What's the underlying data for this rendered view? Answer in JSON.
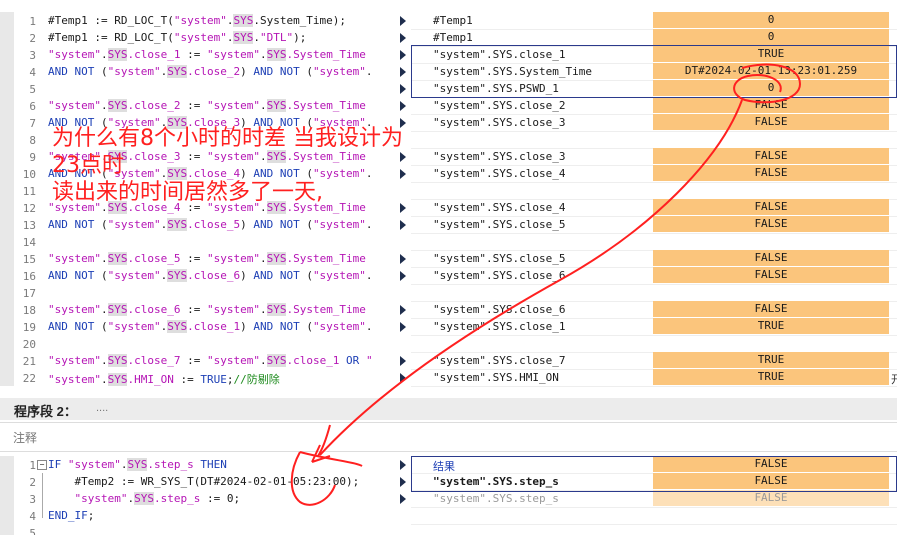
{
  "segment1": {
    "lines": [
      {
        "n": "1",
        "parts": [
          [
            "t",
            "#Temp1 := RD_LOC_T("
          ],
          [
            "s",
            "\"system\""
          ],
          [
            "t",
            "."
          ],
          [
            "y",
            "SYS"
          ],
          [
            "t",
            ".System_Time);"
          ]
        ]
      },
      {
        "n": "2",
        "parts": [
          [
            "t",
            "#Temp1 := RD_LOC_T("
          ],
          [
            "s",
            "\"system\""
          ],
          [
            "t",
            "."
          ],
          [
            "y",
            "SYS"
          ],
          [
            "t",
            "."
          ],
          [
            "s",
            "\"DTL\""
          ],
          [
            "t",
            ");"
          ]
        ]
      },
      {
        "n": "3",
        "parts": [
          [
            "s",
            "\"system\""
          ],
          [
            "t",
            "."
          ],
          [
            "y",
            "SYS"
          ],
          [
            "s",
            ".close_1"
          ],
          [
            "t",
            " := "
          ],
          [
            "s",
            "\"system\""
          ],
          [
            "t",
            "."
          ],
          [
            "y",
            "SYS"
          ],
          [
            "s",
            ".System_Time"
          ]
        ]
      },
      {
        "n": "4",
        "parts": [
          [
            "k",
            "AND NOT "
          ],
          [
            "t",
            "("
          ],
          [
            "s",
            "\"system\""
          ],
          [
            "t",
            "."
          ],
          [
            "y",
            "SYS"
          ],
          [
            "s",
            ".close_2"
          ],
          [
            "t",
            ") "
          ],
          [
            "k",
            "AND NOT "
          ],
          [
            "t",
            "("
          ],
          [
            "s",
            "\"system\""
          ],
          [
            "t",
            "."
          ]
        ]
      },
      {
        "n": "5",
        "parts": []
      },
      {
        "n": "6",
        "parts": [
          [
            "s",
            "\"system\""
          ],
          [
            "t",
            "."
          ],
          [
            "y",
            "SYS"
          ],
          [
            "s",
            ".close_2"
          ],
          [
            "t",
            " := "
          ],
          [
            "s",
            "\"system\""
          ],
          [
            "t",
            "."
          ],
          [
            "y",
            "SYS"
          ],
          [
            "s",
            ".System_Time"
          ]
        ]
      },
      {
        "n": "7",
        "parts": [
          [
            "k",
            "AND NOT "
          ],
          [
            "t",
            "("
          ],
          [
            "s",
            "\"system\""
          ],
          [
            "t",
            "."
          ],
          [
            "y",
            "SYS"
          ],
          [
            "s",
            ".close_3"
          ],
          [
            "t",
            ") "
          ],
          [
            "k",
            "AND NOT "
          ],
          [
            "t",
            "("
          ],
          [
            "s",
            "\"system\""
          ],
          [
            "t",
            "."
          ]
        ]
      },
      {
        "n": "8",
        "parts": []
      },
      {
        "n": "9",
        "parts": [
          [
            "s",
            "\"system\""
          ],
          [
            "t",
            "."
          ],
          [
            "y",
            "SYS"
          ],
          [
            "s",
            ".close_3"
          ],
          [
            "t",
            " := "
          ],
          [
            "s",
            "\"system\""
          ],
          [
            "t",
            "."
          ],
          [
            "y",
            "SYS"
          ],
          [
            "s",
            ".System_Time"
          ]
        ]
      },
      {
        "n": "10",
        "parts": [
          [
            "k",
            "AND NOT "
          ],
          [
            "t",
            "("
          ],
          [
            "s",
            "\"system\""
          ],
          [
            "t",
            "."
          ],
          [
            "y",
            "SYS"
          ],
          [
            "s",
            ".close_4"
          ],
          [
            "t",
            ") "
          ],
          [
            "k",
            "AND NOT "
          ],
          [
            "t",
            "("
          ],
          [
            "s",
            "\"system\""
          ],
          [
            "t",
            "."
          ]
        ]
      },
      {
        "n": "11",
        "parts": []
      },
      {
        "n": "12",
        "parts": [
          [
            "s",
            "\"system\""
          ],
          [
            "t",
            "."
          ],
          [
            "y",
            "SYS"
          ],
          [
            "s",
            ".close_4"
          ],
          [
            "t",
            " := "
          ],
          [
            "s",
            "\"system\""
          ],
          [
            "t",
            "."
          ],
          [
            "y",
            "SYS"
          ],
          [
            "s",
            ".System_Time"
          ]
        ]
      },
      {
        "n": "13",
        "parts": [
          [
            "k",
            "AND NOT "
          ],
          [
            "t",
            "("
          ],
          [
            "s",
            "\"system\""
          ],
          [
            "t",
            "."
          ],
          [
            "y",
            "SYS"
          ],
          [
            "s",
            ".close_5"
          ],
          [
            "t",
            ") "
          ],
          [
            "k",
            "AND NOT "
          ],
          [
            "t",
            "("
          ],
          [
            "s",
            "\"system\""
          ],
          [
            "t",
            "."
          ]
        ]
      },
      {
        "n": "14",
        "parts": []
      },
      {
        "n": "15",
        "parts": [
          [
            "s",
            "\"system\""
          ],
          [
            "t",
            "."
          ],
          [
            "y",
            "SYS"
          ],
          [
            "s",
            ".close_5"
          ],
          [
            "t",
            " := "
          ],
          [
            "s",
            "\"system\""
          ],
          [
            "t",
            "."
          ],
          [
            "y",
            "SYS"
          ],
          [
            "s",
            ".System_Time"
          ]
        ]
      },
      {
        "n": "16",
        "parts": [
          [
            "k",
            "AND NOT "
          ],
          [
            "t",
            "("
          ],
          [
            "s",
            "\"system\""
          ],
          [
            "t",
            "."
          ],
          [
            "y",
            "SYS"
          ],
          [
            "s",
            ".close_6"
          ],
          [
            "t",
            ") "
          ],
          [
            "k",
            "AND NOT "
          ],
          [
            "t",
            "("
          ],
          [
            "s",
            "\"system\""
          ],
          [
            "t",
            "."
          ]
        ]
      },
      {
        "n": "17",
        "parts": []
      },
      {
        "n": "18",
        "parts": [
          [
            "s",
            "\"system\""
          ],
          [
            "t",
            "."
          ],
          [
            "y",
            "SYS"
          ],
          [
            "s",
            ".close_6"
          ],
          [
            "t",
            " := "
          ],
          [
            "s",
            "\"system\""
          ],
          [
            "t",
            "."
          ],
          [
            "y",
            "SYS"
          ],
          [
            "s",
            ".System_Time"
          ]
        ]
      },
      {
        "n": "19",
        "parts": [
          [
            "k",
            "AND NOT "
          ],
          [
            "t",
            "("
          ],
          [
            "s",
            "\"system\""
          ],
          [
            "t",
            "."
          ],
          [
            "y",
            "SYS"
          ],
          [
            "s",
            ".close_1"
          ],
          [
            "t",
            ") "
          ],
          [
            "k",
            "AND NOT "
          ],
          [
            "t",
            "("
          ],
          [
            "s",
            "\"system\""
          ],
          [
            "t",
            "."
          ]
        ]
      },
      {
        "n": "20",
        "parts": []
      },
      {
        "n": "21",
        "parts": [
          [
            "s",
            "\"system\""
          ],
          [
            "t",
            "."
          ],
          [
            "y",
            "SYS"
          ],
          [
            "s",
            ".close_7"
          ],
          [
            "t",
            " := "
          ],
          [
            "s",
            "\"system\""
          ],
          [
            "t",
            "."
          ],
          [
            "y",
            "SYS"
          ],
          [
            "s",
            ".close_1"
          ],
          [
            "k",
            " OR "
          ],
          [
            "s",
            "\""
          ]
        ]
      },
      {
        "n": "22",
        "parts": [
          [
            "s",
            "\"system\""
          ],
          [
            "t",
            "."
          ],
          [
            "y",
            "SYS"
          ],
          [
            "s",
            ".HMI_ON"
          ],
          [
            "t",
            " := "
          ],
          [
            "k",
            "TRUE"
          ],
          [
            "t",
            ";"
          ],
          [
            "c",
            "//防剔除"
          ]
        ]
      }
    ],
    "monitor": [
      {
        "line": 1,
        "name": "#Temp1",
        "value": "0"
      },
      {
        "line": 2,
        "name": "#Temp1",
        "value": "0"
      },
      {
        "line": 3,
        "name": "\"system\".SYS.close_1",
        "value": "TRUE"
      },
      {
        "line": 4,
        "name": "\"system\".SYS.System_Time",
        "value": "DT#2024-02-01-13:23:01.259"
      },
      {
        "line": 5,
        "name": "\"system\".SYS.PSWD_1",
        "value": "0"
      },
      {
        "line": 6,
        "name": "\"system\".SYS.close_2",
        "value": "FALSE"
      },
      {
        "line": 7,
        "name": "\"system\".SYS.close_3",
        "value": "FALSE"
      },
      {
        "line": 9,
        "name": "\"system\".SYS.close_3",
        "value": "FALSE"
      },
      {
        "line": 10,
        "name": "\"system\".SYS.close_4",
        "value": "FALSE"
      },
      {
        "line": 12,
        "name": "\"system\".SYS.close_4",
        "value": "FALSE"
      },
      {
        "line": 13,
        "name": "\"system\".SYS.close_5",
        "value": "FALSE"
      },
      {
        "line": 15,
        "name": "\"system\".SYS.close_5",
        "value": "FALSE"
      },
      {
        "line": 16,
        "name": "\"system\".SYS.close_6",
        "value": "FALSE"
      },
      {
        "line": 18,
        "name": "\"system\".SYS.close_6",
        "value": "FALSE"
      },
      {
        "line": 19,
        "name": "\"system\".SYS.close_1",
        "value": "TRUE"
      },
      {
        "line": 21,
        "name": "\"system\".SYS.close_7",
        "value": "TRUE"
      },
      {
        "line": 22,
        "name": "\"system\".SYS.HMI_ON",
        "value": "TRUE",
        "extra": "开"
      }
    ],
    "marker_lines": [
      1,
      2,
      3,
      4,
      5,
      6,
      7,
      9,
      10,
      12,
      13,
      15,
      16,
      18,
      19,
      21,
      22
    ]
  },
  "segment2": {
    "label": "程序段 2：",
    "dots": "....",
    "comment_label": "注释",
    "lines": [
      {
        "n": "1",
        "fold": "−",
        "parts": [
          [
            "k",
            "IF "
          ],
          [
            "s",
            "\"system\""
          ],
          [
            "t",
            "."
          ],
          [
            "y",
            "SYS"
          ],
          [
            "s",
            ".step_s"
          ],
          [
            "k",
            " THEN"
          ]
        ]
      },
      {
        "n": "2",
        "parts": [
          [
            "t",
            "    #Temp2 := WR_SYS_T(DT#2024-02-01-05:23:00);"
          ]
        ]
      },
      {
        "n": "3",
        "parts": [
          [
            "t",
            "    "
          ],
          [
            "s",
            "\"system\""
          ],
          [
            "t",
            "."
          ],
          [
            "y",
            "SYS"
          ],
          [
            "s",
            ".step_s"
          ],
          [
            "t",
            " := 0;"
          ]
        ]
      },
      {
        "n": "4",
        "parts": [
          [
            "k",
            "END_IF"
          ],
          [
            "t",
            ";"
          ]
        ]
      },
      {
        "n": "5",
        "parts": []
      }
    ],
    "monitor": [
      {
        "line": 1,
        "name": "结果",
        "value": "FALSE",
        "nameColor": "#1d3fb5"
      },
      {
        "line": 2,
        "name": "\"system\".SYS.step_s",
        "value": "FALSE",
        "bold": true
      },
      {
        "line": 3,
        "name": "\"system\".SYS.step_s",
        "value": "FALSE",
        "gray": true
      }
    ],
    "marker_lines": [
      1,
      2,
      3
    ]
  },
  "annotation": {
    "text": "为什么有8个小时的时差 当我设计为\n23点时\n读出来的时间居然多了一天,",
    "color": "#ff2020"
  },
  "colors": {
    "value_bg": "#fbc57c",
    "keyword": "#1d3fb5",
    "string": "#b515b5",
    "comment": "#1c8a1c",
    "box": "#2b3a8c"
  }
}
